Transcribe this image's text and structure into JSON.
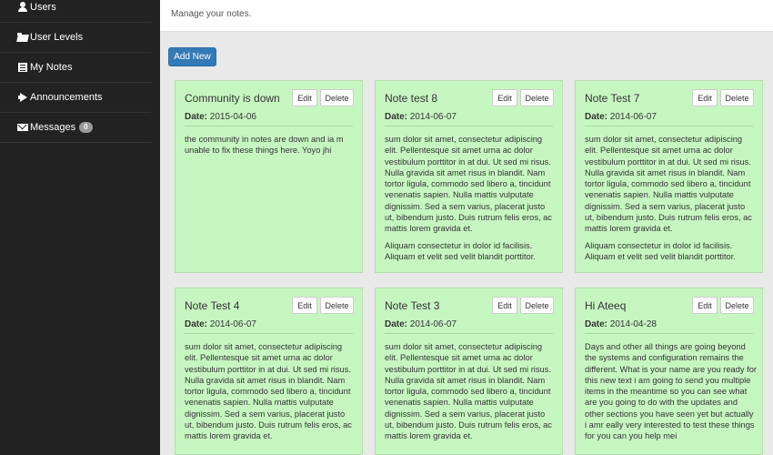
{
  "sidebar": {
    "items": [
      {
        "label": "Users",
        "icon": "user-icon"
      },
      {
        "label": "User Levels",
        "icon": "folder-open-icon"
      },
      {
        "label": "My Notes",
        "icon": "notes-icon"
      },
      {
        "label": "Announcements",
        "icon": "bullhorn-icon"
      },
      {
        "label": "Messages",
        "icon": "envelope-icon",
        "badge": "0"
      }
    ]
  },
  "header": {
    "subtitle": "Manage your notes."
  },
  "toolbar": {
    "add_label": "Add New"
  },
  "colors": {
    "sidebar_bg": "#222222",
    "card_bg": "#c7f7c1",
    "primary": "#337ab7"
  },
  "card_labels": {
    "edit": "Edit",
    "delete": "Delete",
    "date_label": "Date:"
  },
  "notes": [
    {
      "title": "Community is down",
      "date": "2015-04-06",
      "paragraphs": [
        "the community in notes are down and ia m unable to fix these things here. Yoyo jhi"
      ]
    },
    {
      "title": "Note test 8",
      "date": "2014-06-07",
      "paragraphs": [
        "sum dolor sit amet, consectetur adipiscing elit. Pellentesque sit amet urna ac dolor vestibulum porttitor in at dui. Ut sed mi risus. Nulla gravida sit amet risus in blandit. Nam tortor ligula, commodo sed libero a, tincidunt venenatis sapien. Nulla mattis vulputate dignissim. Sed a sem varius, placerat justo ut, bibendum justo. Duis rutrum felis eros, ac mattis lorem gravida et.",
        "Aliquam consectetur in dolor id facilisis. Aliquam et velit sed velit blandit porttitor."
      ]
    },
    {
      "title": "Note Test 7",
      "date": "2014-06-07",
      "paragraphs": [
        "sum dolor sit amet, consectetur adipiscing elit. Pellentesque sit amet urna ac dolor vestibulum porttitor in at dui. Ut sed mi risus. Nulla gravida sit amet risus in blandit. Nam tortor ligula, commodo sed libero a, tincidunt venenatis sapien. Nulla mattis vulputate dignissim. Sed a sem varius, placerat justo ut, bibendum justo. Duis rutrum felis eros, ac mattis lorem gravida et.",
        "Aliquam consectetur in dolor id facilisis. Aliquam et velit sed velit blandit porttitor."
      ]
    },
    {
      "title": "Note Test 4",
      "date": "2014-06-07",
      "paragraphs": [
        "sum dolor sit amet, consectetur adipiscing elit. Pellentesque sit amet urna ac dolor vestibulum porttitor in at dui. Ut sed mi risus. Nulla gravida sit amet risus in blandit. Nam tortor ligula, commodo sed libero a, tincidunt venenatis sapien. Nulla mattis vulputate dignissim. Sed a sem varius, placerat justo ut, bibendum justo. Duis rutrum felis eros, ac mattis lorem gravida et."
      ]
    },
    {
      "title": "Note Test 3",
      "date": "2014-06-07",
      "paragraphs": [
        "sum dolor sit amet, consectetur adipiscing elit. Pellentesque sit amet urna ac dolor vestibulum porttitor in at dui. Ut sed mi risus. Nulla gravida sit amet risus in blandit. Nam tortor ligula, commodo sed libero a, tincidunt venenatis sapien. Nulla mattis vulputate dignissim. Sed a sem varius, placerat justo ut, bibendum justo. Duis rutrum felis eros, ac mattis lorem gravida et."
      ]
    },
    {
      "title": "Hi Ateeq",
      "date": "2014-04-28",
      "paragraphs": [
        "Days and other all things are going beyond the systems and configuration remains the different. What is your name are you ready for this new text i am going to send you multiple items in the meantime so you can see what are you going to do with the updates and other sections you have seen yet but actually i amr eally very interested to test these things for you can you help mei"
      ]
    }
  ]
}
